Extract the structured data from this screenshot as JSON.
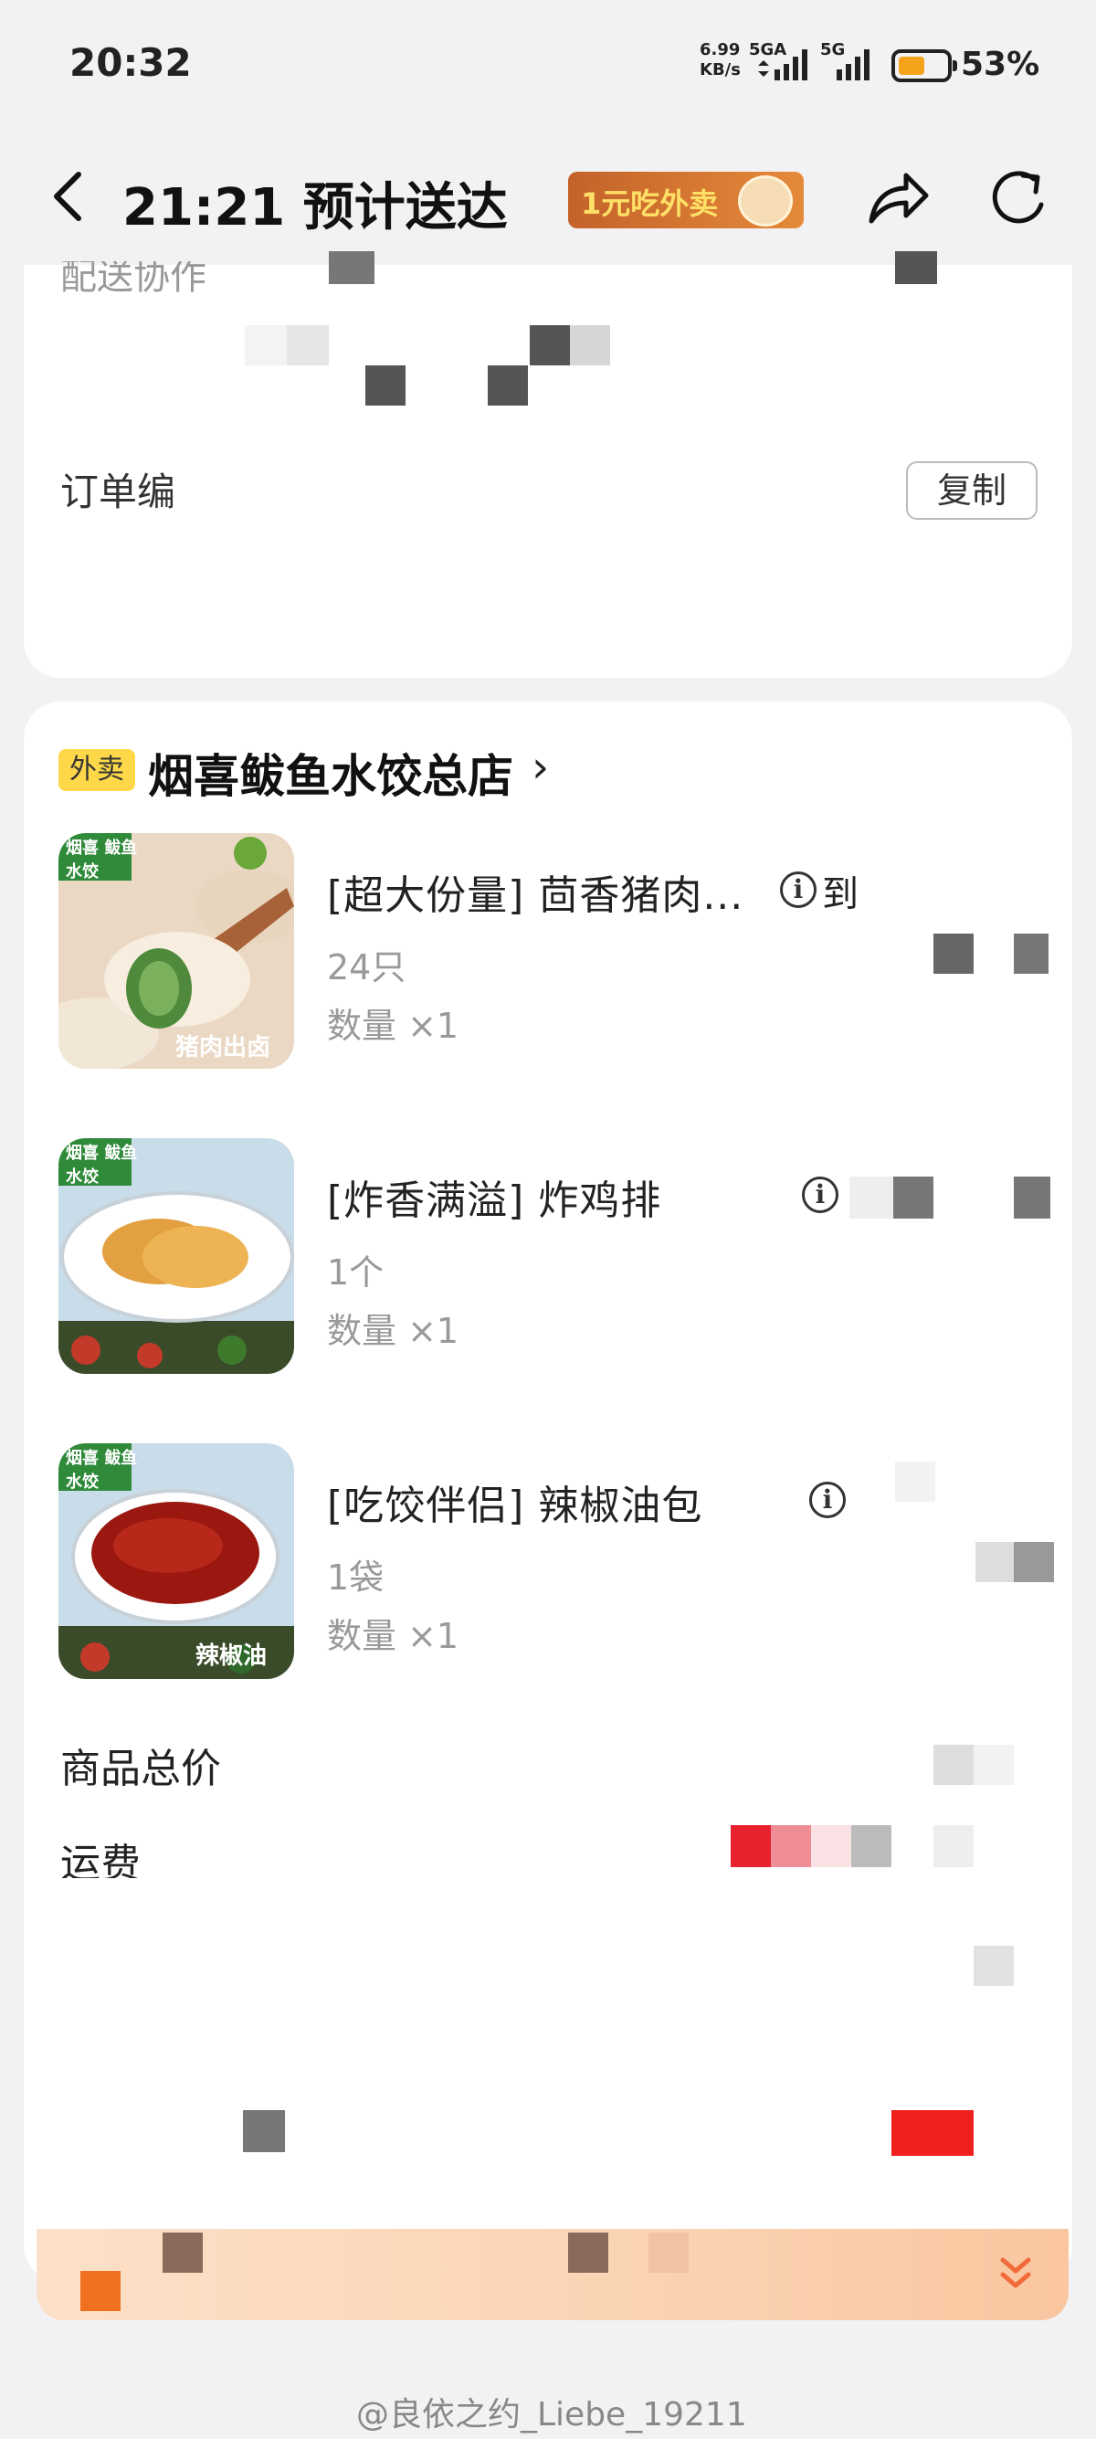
{
  "status_bar": {
    "time": "20:32",
    "net_speed_value": "6.99",
    "net_speed_unit": "KB/s",
    "sim1_label": "5GA",
    "sim2_label": "5G",
    "battery_percent": "53%",
    "battery_level": 0.53
  },
  "header": {
    "title": "21:21 预计送达",
    "promo_label": "1元吃外卖"
  },
  "order_info": {
    "delivery_label": "配送协作",
    "order_no_label": "订单编",
    "copy_button": "复制"
  },
  "shop": {
    "tag": "外卖",
    "name": "烟喜鲅鱼水饺总店",
    "arrow": "›"
  },
  "items": [
    {
      "title": "[超大份量] 茴香猪肉...",
      "spec": "24只",
      "qty": "数量 ×1",
      "info_suffix": "到",
      "thumb_label_top": "烟喜 鲅鱼水饺",
      "thumb_label_bottom": "猪肉出卤"
    },
    {
      "title": "[炸香满溢] 炸鸡排",
      "spec": "1个",
      "qty": "数量 ×1",
      "info_suffix": "",
      "thumb_label_top": "烟喜 鲅鱼水饺",
      "thumb_label_bottom": ""
    },
    {
      "title": "[吃饺伴侣] 辣椒油包",
      "spec": "1袋",
      "qty": "数量 ×1",
      "info_suffix": "",
      "thumb_label_top": "烟喜 鲅鱼水饺",
      "thumb_label_bottom": "辣椒油"
    }
  ],
  "totals": {
    "goods_total_label": "商品总价",
    "freight_label": "运费"
  },
  "watermark": "@良依之约_Liebe_19211",
  "colors": {
    "accent_yellow": "#ffd84a",
    "promo_orange": "#e58a3a",
    "price_red": "#e8212e"
  }
}
